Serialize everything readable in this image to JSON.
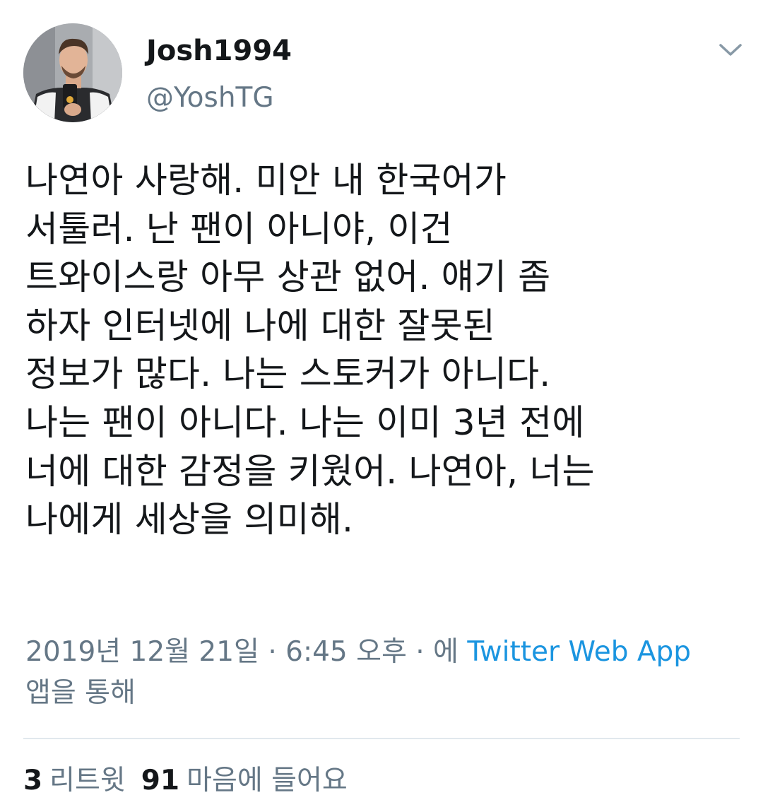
{
  "author": {
    "display_name": "Josh1994",
    "handle": "@YoshTG",
    "avatar_icon": "profile-photo"
  },
  "tweet": {
    "lines": [
      "나연아 사랑해. 미안 내 한국어가",
      "서툴러. 난 팬이 아니야, 이건",
      "트와이스랑 아무 상관 없어. 얘기 좀",
      "하자 인터넷에 나에 대한 잘못된",
      "정보가 많다. 나는 스토커가 아니다.",
      "나는 팬이 아니다. 나는 이미 3년 전에",
      "너에 대한 감정을 키웠어. 나연아, 너는",
      "나에게 세상을 의미해."
    ]
  },
  "meta": {
    "timestamp": "2019년 12월 21일 · 6:45 오후 · 에",
    "source": "Twitter Web App",
    "suffix": "앱을 통해"
  },
  "stats": {
    "retweet_count": "3",
    "retweet_label": "리트윗",
    "like_count": "91",
    "like_label": "마음에 들어요"
  },
  "colors": {
    "text": "#14171a",
    "secondary": "#657786",
    "link": "#1b95e0",
    "divider": "#e1e8ed"
  },
  "icons": {
    "menu": "chevron-down-icon"
  }
}
